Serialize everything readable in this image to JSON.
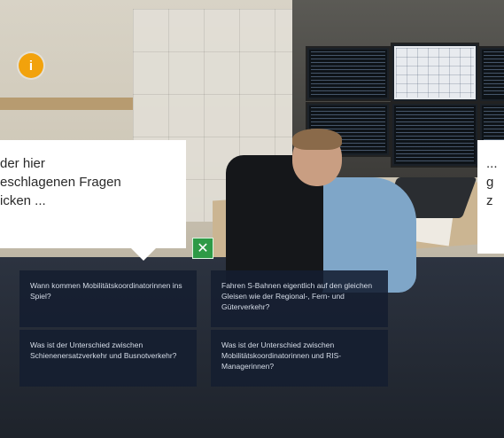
{
  "info": {
    "icon": "info-icon",
    "glyph": "i",
    "color": "#f2a20c"
  },
  "bubble_left": {
    "lines": [
      "der hier",
      "eschlagenen Fragen",
      "icken ..."
    ]
  },
  "bubble_right": {
    "lines": [
      "...",
      "g",
      "z"
    ]
  },
  "close": {
    "icon": "close-icon",
    "glyph": "✕",
    "color": "#2e9a46"
  },
  "questions": [
    {
      "text": "Wann kommen Mobilitätskoordinatorinnen ins Spiel?"
    },
    {
      "text": "Fahren S-Bahnen eigentlich auf den gleichen Gleisen wie der Regional-, Fern- und Güterverkehr?"
    },
    {
      "text": "Was ist der Unterschied zwischen Schienenersatzverkehr und Busnotverkehr?"
    },
    {
      "text": "Was ist der Unterschied zwischen Mobilitätskoordinatorinnen und RIS-Managerinnen?"
    }
  ]
}
